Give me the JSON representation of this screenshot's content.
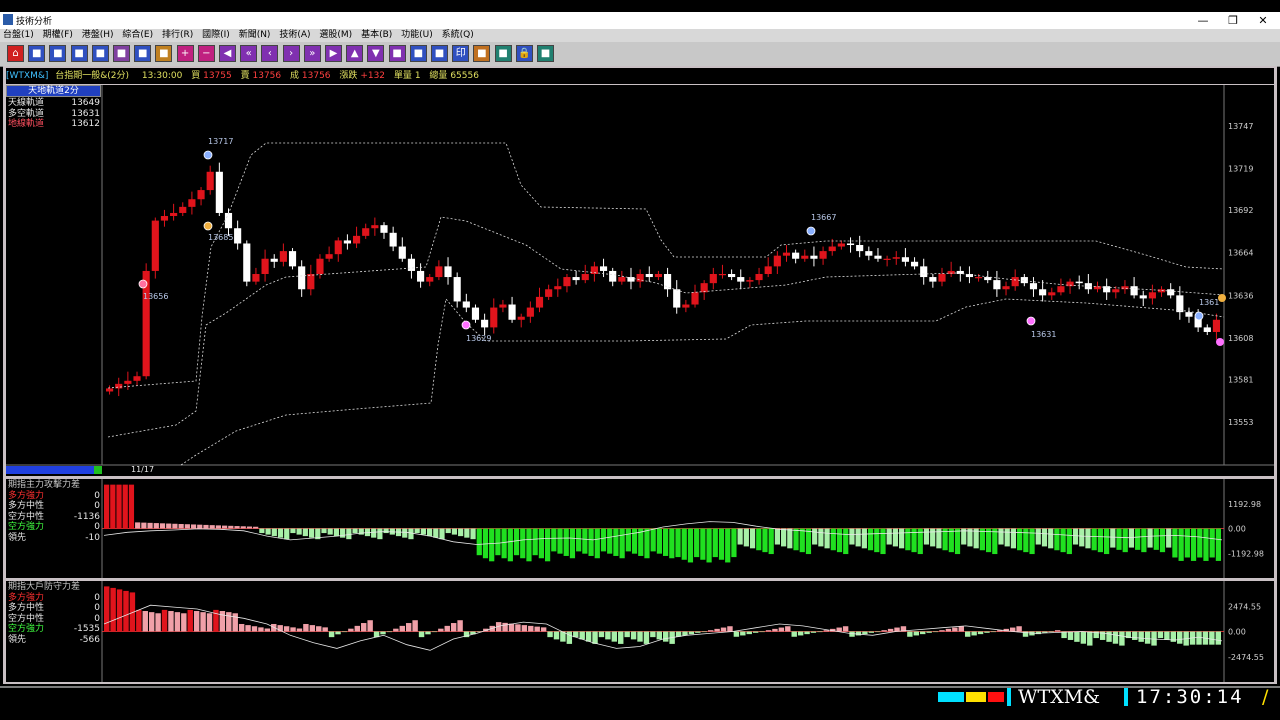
{
  "window": {
    "title": "技術分析",
    "buttons": [
      "—",
      "❐",
      "✕"
    ]
  },
  "menu": [
    "台盤(1)",
    "期權(F)",
    "港盤(H)",
    "綜合(E)",
    "排行(R)",
    "國際(I)",
    "新聞(N)",
    "技術(A)",
    "選股(M)",
    "基本(B)",
    "功能(U)",
    "系統(Q)"
  ],
  "toolbar_icons": [
    "home-icon",
    "chart-icon",
    "list-icon",
    "table-icon",
    "money-icon",
    "grid-icon",
    "calc-icon",
    "book-icon",
    "plus-icon",
    "minus-icon",
    "left-icon",
    "double-left-icon",
    "prev-icon",
    "next-icon",
    "double-right-icon",
    "right-icon",
    "up-icon",
    "down-icon",
    "page-icon",
    "link-icon",
    "link2-icon",
    "print-icon",
    "palette-icon",
    "refresh-icon",
    "lock-icon",
    "save-icon"
  ],
  "quote": {
    "symbol": "[WTXM&]",
    "name": "台指期一般&(2分)",
    "time": "13:30:00",
    "bid_label": "買",
    "bid": "13755",
    "ask_label": "賣",
    "ask": "13756",
    "last_label": "成",
    "last": "13756",
    "change_label": "漲跌",
    "change": "+132",
    "vol_label": "單量",
    "vol": "1",
    "total_label": "總量",
    "total": "65556"
  },
  "main_panel": {
    "title": "天地軌道2分",
    "rows": [
      {
        "label": "天線軌道",
        "value": "13649",
        "color": "#e8e8e8"
      },
      {
        "label": "多空軌道",
        "value": "13631",
        "color": "#e8e8e8"
      },
      {
        "label": "地線軌道",
        "value": "13612",
        "color": "#ff5060"
      }
    ],
    "y_ticks": [
      "13747",
      "13719",
      "13692",
      "13664",
      "13636",
      "13608",
      "13581",
      "13553"
    ],
    "date_label": "11/17",
    "markers": [
      "13717",
      "13685",
      "13656",
      "13629",
      "13667",
      "13631",
      "1361"
    ]
  },
  "panel2": {
    "title": "期指主力攻擊力差",
    "rows": [
      {
        "label": "多方強力",
        "value": "0",
        "color": "#ff3030"
      },
      {
        "label": "多方中性",
        "value": "0",
        "color": "#e8e8e8"
      },
      {
        "label": "空方中性",
        "value": "-1136",
        "color": "#e8e8e8"
      },
      {
        "label": "空方強力",
        "value": "0",
        "color": "#40ff40"
      },
      {
        "label": "領先",
        "value": "-10",
        "color": "#e8e8e8"
      }
    ],
    "y_ticks": [
      "1192.98",
      "0.00",
      "-1192.98"
    ]
  },
  "panel3": {
    "title": "期指大戶防守力差",
    "rows": [
      {
        "label": "多方強力",
        "value": "0",
        "color": "#ff3030"
      },
      {
        "label": "多方中性",
        "value": "0",
        "color": "#e8e8e8"
      },
      {
        "label": "空方中性",
        "value": "0",
        "color": "#e8e8e8"
      },
      {
        "label": "空方強力",
        "value": "-1535",
        "color": "#40ff40"
      },
      {
        "label": "領先",
        "value": "-566",
        "color": "#e8e8e8"
      }
    ],
    "y_ticks": [
      "2474.55",
      "0.00",
      "-2474.55"
    ]
  },
  "status_bar": {
    "symbol": "WTXM&",
    "clock": "17:30:14"
  },
  "colors": {
    "up": "#e0141c",
    "down": "#ffffff",
    "strong_bull": "#e0141c",
    "neutral_bull": "#f0a0a8",
    "neutral_bear": "#a8f0a8",
    "strong_bear": "#20e020"
  }
}
